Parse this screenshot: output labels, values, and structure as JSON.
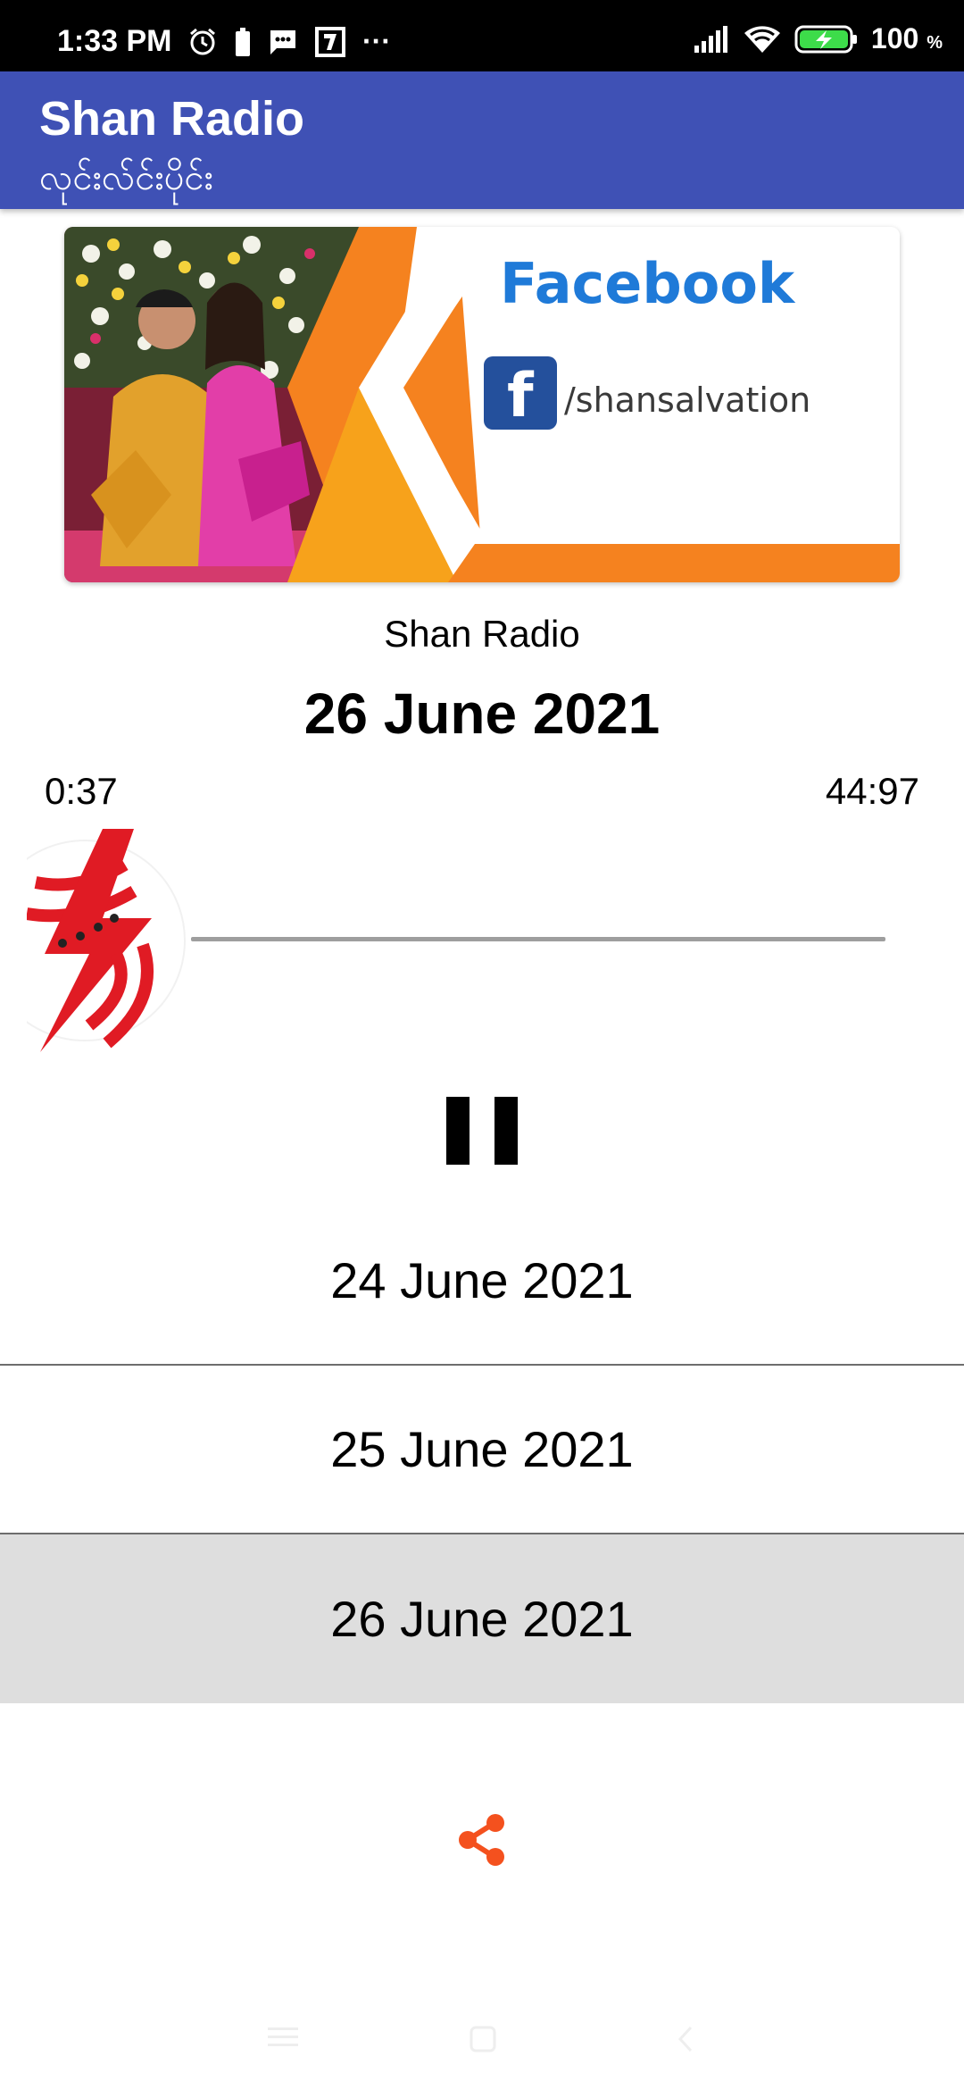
{
  "status_bar": {
    "time": "1:33 PM",
    "battery_percent": "100",
    "battery_unit": "%",
    "more_indicator": "···",
    "icons": [
      "alarm-icon",
      "battery-saver-icon",
      "message-icon",
      "seven-eleven-icon",
      "signal-icon",
      "wifi-icon",
      "battery-charging-icon"
    ]
  },
  "app_bar": {
    "title": "Shan Radio",
    "subtitle": "လုင်းလ်င်းပိုင်း",
    "color": "#3f51b5"
  },
  "banner": {
    "heading": "Facebook",
    "handle": "/shansalvation",
    "facebook_glyph": "f",
    "accent_colors": [
      "#f7a21b",
      "#f5821f",
      "#1877f2"
    ]
  },
  "player": {
    "station": "Shan Radio",
    "current_episode": "26 June 2021",
    "elapsed": "0:37",
    "total": "44:97",
    "progress_fraction": 0.01,
    "state": "playing"
  },
  "episodes": [
    {
      "label": "24 June 2021",
      "selected": false
    },
    {
      "label": "25 June 2021",
      "selected": false
    },
    {
      "label": "26 June 2021",
      "selected": true
    }
  ],
  "share": {
    "icon": "share-icon",
    "color": "#f4511e"
  },
  "nav_bar": {
    "buttons": [
      "menu-icon",
      "home-square-icon",
      "back-chevron-icon"
    ]
  }
}
